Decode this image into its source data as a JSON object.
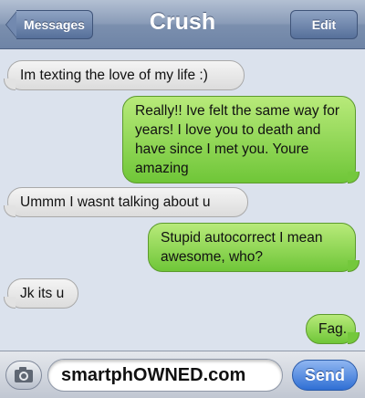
{
  "header": {
    "title": "Crush",
    "back_label": "Messages",
    "edit_label": "Edit"
  },
  "messages": [
    {
      "from": "them",
      "text": "Im texting the love of my life :)"
    },
    {
      "from": "me",
      "text": "Really!! Ive felt the same way for years! I love you to death and have since I met you. Youre amazing"
    },
    {
      "from": "them",
      "text": "Ummm I wasnt talking about u"
    },
    {
      "from": "me",
      "text": "Stupid autocorrect I mean awesome, who?"
    },
    {
      "from": "them",
      "text": "Jk its u"
    },
    {
      "from": "me",
      "text": "Fag."
    }
  ],
  "composer": {
    "field_text": "smartphOWNED.com",
    "send_label": "Send",
    "camera_icon": "camera-icon"
  },
  "colors": {
    "sent_bubble": "#7ccc3f",
    "received_bubble": "#e6e6e6",
    "send_button": "#3a79dc"
  }
}
